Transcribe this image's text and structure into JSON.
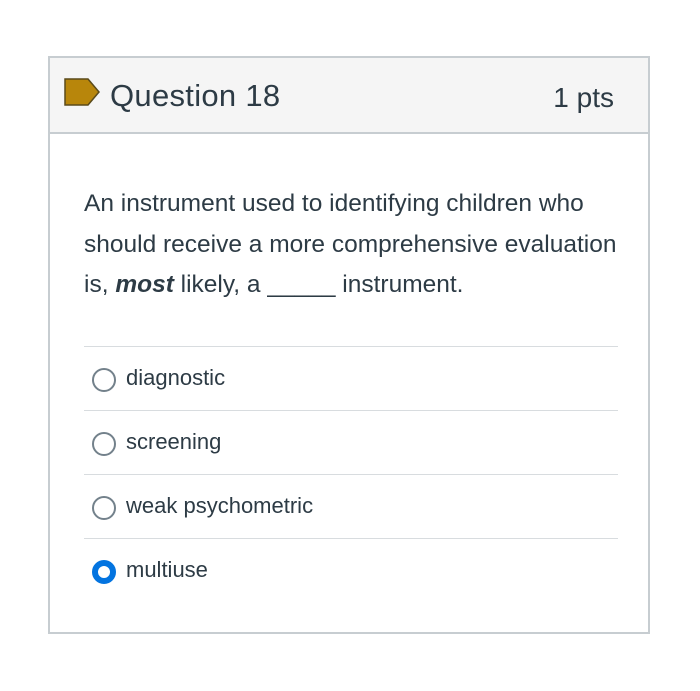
{
  "question": {
    "title": "Question 18",
    "points": "1 pts",
    "flag_icon": "flag-icon",
    "flag_color": "#b8860b",
    "text_part1": "An instrument used to identifying children who should receive a more comprehensive evaluation is, ",
    "text_emphasis": "most",
    "text_part2": " likely, a _____ instrument."
  },
  "answers": [
    {
      "label": "diagnostic",
      "selected": false
    },
    {
      "label": "screening",
      "selected": false
    },
    {
      "label": "weak psychometric",
      "selected": false
    },
    {
      "label": "multiuse",
      "selected": true
    }
  ],
  "colors": {
    "selected_radio": "#0374e0",
    "text": "#2d3b45",
    "header_bg": "#f5f5f5",
    "border": "#c7cdd1"
  }
}
